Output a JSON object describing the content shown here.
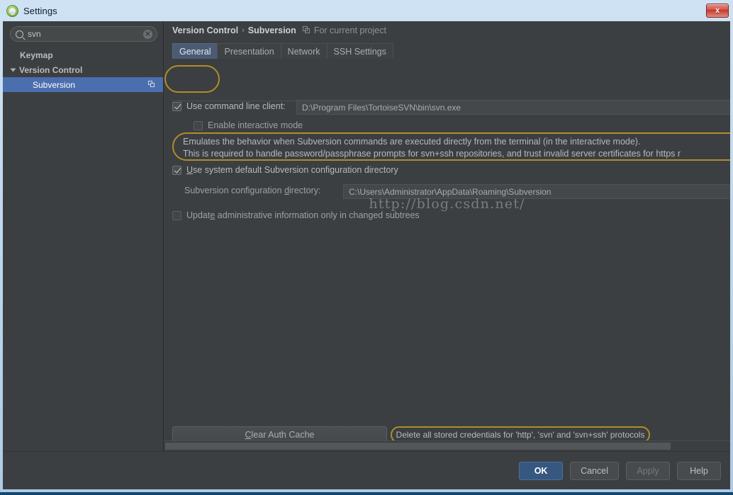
{
  "window": {
    "title": "Settings",
    "app_icon": "android-robot-icon",
    "close_label": "x"
  },
  "sidebar": {
    "search": {
      "value": "svn",
      "placeholder": "",
      "search_icon": "search-icon",
      "clear_icon": "clear-icon"
    },
    "items": [
      {
        "label": "Keymap",
        "level": 0,
        "selected": false,
        "expandable": false,
        "badge": false
      },
      {
        "label": "Version Control",
        "level": 0,
        "selected": false,
        "expandable": true,
        "badge": false
      },
      {
        "label": "Subversion",
        "level": 1,
        "selected": true,
        "expandable": false,
        "badge": true
      }
    ]
  },
  "breadcrumb": {
    "root": "Version Control",
    "separator": "›",
    "current": "Subversion",
    "scope_icon": "project-scope-icon",
    "scope": "For current project"
  },
  "tabs": [
    {
      "label": "General",
      "active": true
    },
    {
      "label": "Presentation",
      "active": false
    },
    {
      "label": "Network",
      "active": false
    },
    {
      "label": "SSH Settings",
      "active": false
    }
  ],
  "settings": {
    "use_command_line_client": {
      "label": "Use command line client:",
      "checked": true,
      "value": "D:\\Program Files\\TortoiseSVN\\bin\\svn.exe"
    },
    "enable_interactive_mode": {
      "label": "Enable interactive mode",
      "checked": false
    },
    "interactive_description": [
      "Emulates the behavior when Subversion commands are executed directly from the terminal (in the interactive mode).",
      "This is required to handle password/passphrase prompts for svn+ssh repositories, and trust invalid server certificates for https r"
    ],
    "use_system_default_config_dir": {
      "label": "Use system default Subversion configuration directory",
      "checked": true
    },
    "config_directory": {
      "label": "Subversion configuration directory:",
      "value": "C:\\Users\\Administrator\\AppData\\Roaming\\Subversion"
    },
    "update_admin_info": {
      "label": "Update administrative information only in changed subtrees",
      "checked": false
    }
  },
  "watermark": "http://blog.csdn.net/",
  "pane_buttons": {
    "clear_auth_cache": "Clear Auth Cache",
    "delete_credentials": "Delete all stored credentials for 'http', 'svn' and 'svn+ssh' protocols"
  },
  "footer_buttons": [
    {
      "label": "OK",
      "style": "primary"
    },
    {
      "label": "Cancel",
      "style": "normal"
    },
    {
      "label": "Apply",
      "style": "disabled"
    },
    {
      "label": "Help",
      "style": "normal"
    }
  ],
  "colors": {
    "accent_selection": "#4b6eaf",
    "highlight_ring": "#b08d29",
    "dialog_bg": "#3c3f41",
    "primary_button": "#365880"
  }
}
